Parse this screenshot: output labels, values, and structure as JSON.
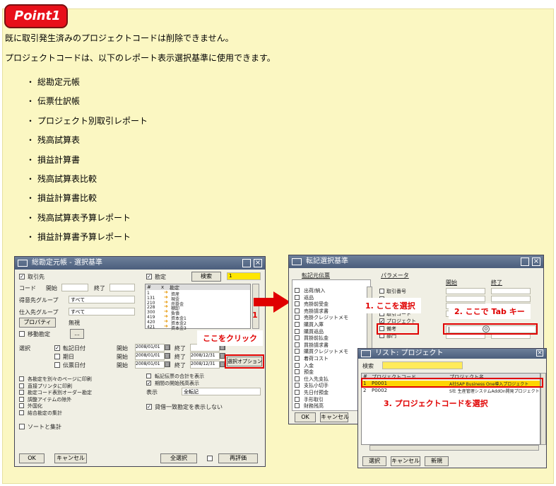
{
  "badge": "Point1",
  "intro1": "既に取引発生済みのプロジェクトコードは削除できません。",
  "intro2": "プロジェクトコードは、以下のレポート表示選択基準に使用できます。",
  "bullet_mark": "・",
  "reports": [
    "総勘定元帳",
    "伝票仕訳帳",
    "プロジェクト別取引レポート",
    "残高試算表",
    "損益計算書",
    "残高試算表比較",
    "損益計算書比較",
    "残高試算表予算レポート",
    "損益計算書予算レポート"
  ],
  "left_window": {
    "title": "総勘定元帳 - 選択基準",
    "bp_label": "取引先",
    "code_label": "コード",
    "from_label": "開始",
    "to_label": "終了",
    "customer_group_label": "得意先グループ",
    "vendor_group_label": "仕入先グループ",
    "all_value": "すべて",
    "properties_button": "プロパティ",
    "ignore_value": "無視",
    "inactive_label": "移動勘定",
    "ellipsis_button": "...",
    "account_label": "勘定",
    "search_button": "検索",
    "level_value": "1",
    "grid_headers": [
      "#",
      "x",
      "勘定"
    ],
    "grid_rows": [
      [
        "1",
        "",
        "資産"
      ],
      [
        "131",
        "",
        "現金"
      ],
      [
        "210",
        "",
        "売掛金"
      ],
      [
        "228",
        "",
        "棚卸"
      ],
      [
        "300",
        "",
        "負債"
      ],
      [
        "419",
        "",
        "資本金1"
      ],
      [
        "420",
        "",
        "資本金2"
      ],
      [
        "421",
        "",
        "資本金3"
      ]
    ],
    "selection_label": "選択",
    "date_options": [
      "転記日付",
      "期日",
      "伝票日付"
    ],
    "from_dates": [
      "2008/01/01",
      "2008/01/01",
      "2008/01/01"
    ],
    "to_dates": [
      "",
      "2008/12/31",
      "2008/12/31"
    ],
    "number_1": "1",
    "select_options_button": "選択オプション",
    "click_here": "ここをクリック",
    "left_options": [
      "各勘定を別々のページに印刷",
      "直接プリンタに印刷",
      "勘定コード表別オーダー勘定",
      "調整アイテムの除外",
      "外国化",
      "結合勘定の集計"
    ],
    "sort_label": "ソートと集計",
    "right_options": [
      "転記伝票の合計を表示",
      "期間の開始残高表示"
    ],
    "display_label": "表示",
    "display_value": "全転記",
    "hide_zero": "貸借一致勘定を表示しない",
    "ok_button": "OK",
    "cancel_button": "キャンセル",
    "select_all_button": "全選択",
    "reset_button": "再評価"
  },
  "right_window": {
    "title": "転記選択基準",
    "posting_tab": "転記元伝票",
    "params_tab": "パラメータ",
    "start_col": "開始",
    "end_col": "終了",
    "doc_types": [
      "出荷/納入",
      "返品",
      "売掛前受金",
      "売掛請求書",
      "売掛クレジットメモ",
      "購買入庫",
      "購買返品",
      "買掛前払金",
      "買掛請求書",
      "購買クレジットメモ",
      "着荷コスト",
      "入金",
      "預金",
      "仕入先支払",
      "支払小切手",
      "先日付預金",
      "手形取引",
      "財務残高"
    ],
    "params": [
      "取引番号",
      "",
      "",
      "取引コード",
      "プロジェクト",
      "備考",
      "部門"
    ],
    "ok_button": "OK",
    "cancel_button": "キャンセル",
    "select_here": "1. ここを選択",
    "tab_key": "2. ここで Tab キー",
    "cursor_value": "|"
  },
  "list_window": {
    "title": "リスト: プロジェクト",
    "search_label": "検索",
    "col_num": "#",
    "col_code": "プロジェクトコード",
    "col_name": "プロジェクト名",
    "rows": [
      [
        "1",
        "P0001",
        "A社SAP Business One導入プロジェクト"
      ],
      [
        "2",
        "P0002",
        "S社 生産管理システムAddOn開発プロジェクト"
      ]
    ],
    "select_code": "3. プロジェクトコードを選択",
    "select_button": "選択",
    "cancel_button": "キャンセル",
    "new_button": "新規"
  },
  "colors": {
    "accent": "#e00000",
    "panel": "#fbf7c2",
    "title": "#4b5e7c",
    "highlight": "#ffd400"
  }
}
